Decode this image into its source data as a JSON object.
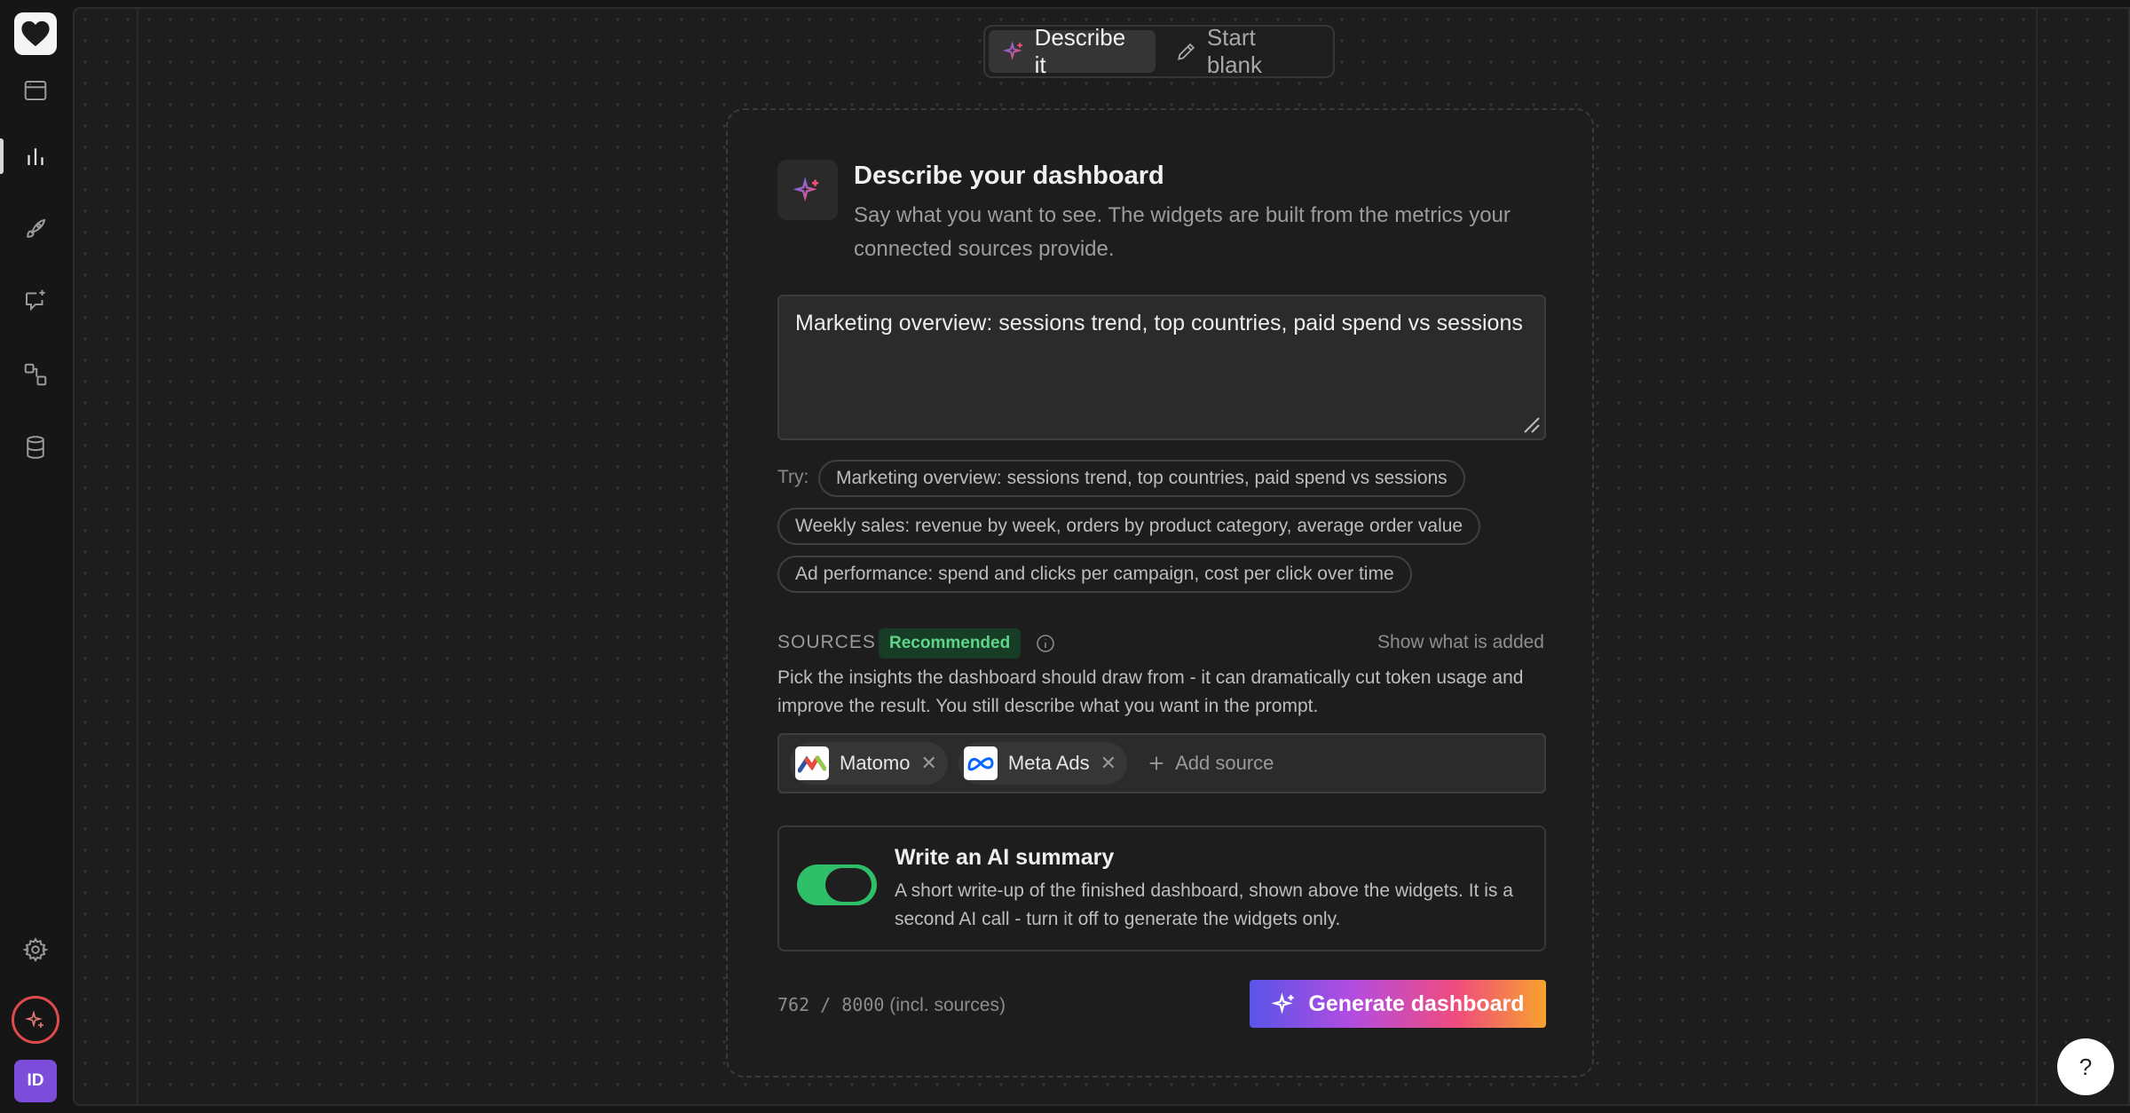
{
  "sidebar": {
    "logo": "heart-logo",
    "items": [
      {
        "name": "sidebar-item-pages",
        "icon": "browser-window-icon"
      },
      {
        "name": "sidebar-item-dashboards",
        "icon": "bar-chart-icon",
        "active": true
      },
      {
        "name": "sidebar-item-launch",
        "icon": "rocket-icon"
      },
      {
        "name": "sidebar-item-chat",
        "icon": "chat-sparkle-icon"
      },
      {
        "name": "sidebar-item-integrations",
        "icon": "connections-icon"
      },
      {
        "name": "sidebar-item-data",
        "icon": "database-icon"
      }
    ],
    "settings_icon": "gear-icon",
    "ai_icon": "sparkle-icon",
    "avatar_initials": "ID"
  },
  "mode_toggle": {
    "describe_label": "Describe it",
    "blank_label": "Start blank",
    "active": "describe"
  },
  "card": {
    "title": "Describe your dashboard",
    "subtitle": "Say what you want to see. The widgets are built from the metrics your connected sources provide.",
    "prompt_value": "Marketing overview: sessions trend, top countries, paid spend vs sessions",
    "try_label": "Try:",
    "suggestions": [
      "Marketing overview: sessions trend, top countries, paid spend vs sessions",
      "Weekly sales: revenue by week, orders by product category, average order value",
      "Ad performance: spend and clicks per campaign, cost per click over time"
    ]
  },
  "sources": {
    "label": "SOURCES",
    "badge": "Recommended",
    "show_added": "Show what is added",
    "description": "Pick the insights the dashboard should draw from - it can dramatically cut token usage and improve the result. You still describe what you want in the prompt.",
    "items": [
      "Matomo",
      "Meta Ads"
    ],
    "add_label": "Add source"
  },
  "summary": {
    "title": "Write an AI summary",
    "description": "A short write-up of the finished dashboard, shown above the widgets. It is a second AI call - turn it off to generate the widgets only.",
    "enabled": true
  },
  "footer": {
    "char_count": "762 / 8000",
    "char_suffix": "(incl. sources)",
    "generate_label": "Generate dashboard"
  },
  "help_label": "?",
  "colors": {
    "toggle_on": "#2fbf68",
    "badge_green": "#5fd58a",
    "avatar": "#7c4ddb",
    "ai_ring": "#e14a4a"
  }
}
